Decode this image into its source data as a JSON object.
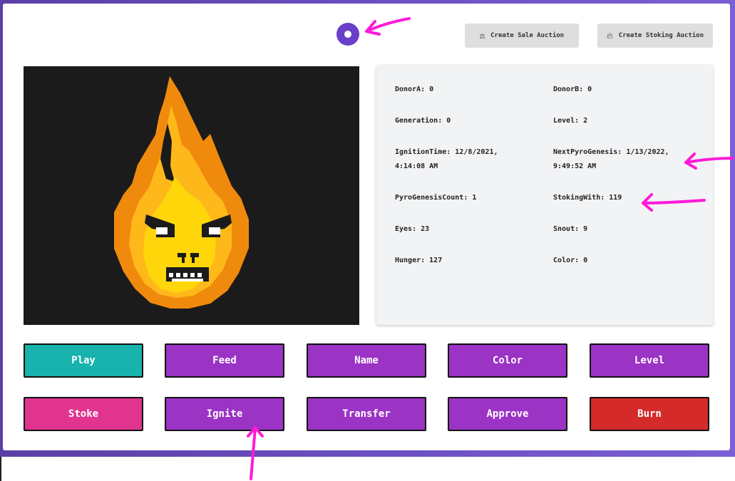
{
  "header": {
    "sale_auction_label": "Create Sale Auction",
    "stoking_auction_label": "Create Stoking Auction",
    "sale_icon": "scale-icon",
    "stoking_icon": "flame-icon"
  },
  "stats": {
    "donorA": "DonorA: 0",
    "donorB": "DonorB: 0",
    "generation": "Generation: 0",
    "level": "Level: 2",
    "ignition_line1": "IgnitionTime: 12/8/2021,",
    "ignition_line2": "4:14:08 AM",
    "next_line1": "NextPyroGenesis: 1/13/2022,",
    "next_line2": "9:49:52 AM",
    "pyro_count": "PyroGenesisCount: 1",
    "stoking_with": "StokingWith: 119",
    "eyes": "Eyes: 23",
    "snout": "Snout: 9",
    "hunger": "Hunger: 127",
    "color": "Color: 0"
  },
  "actions": {
    "play": "Play",
    "feed": "Feed",
    "name": "Name",
    "color": "Color",
    "level": "Level",
    "stoke": "Stoke",
    "ignite": "Ignite",
    "transfer": "Transfer",
    "approve": "Approve",
    "burn": "Burn"
  },
  "colors": {
    "frame": "#6a4fc0",
    "teal": "#17b3ac",
    "purple": "#9b33c5",
    "pink": "#e0348f",
    "red": "#d42a2a",
    "annotation": "#ff1ad9"
  }
}
